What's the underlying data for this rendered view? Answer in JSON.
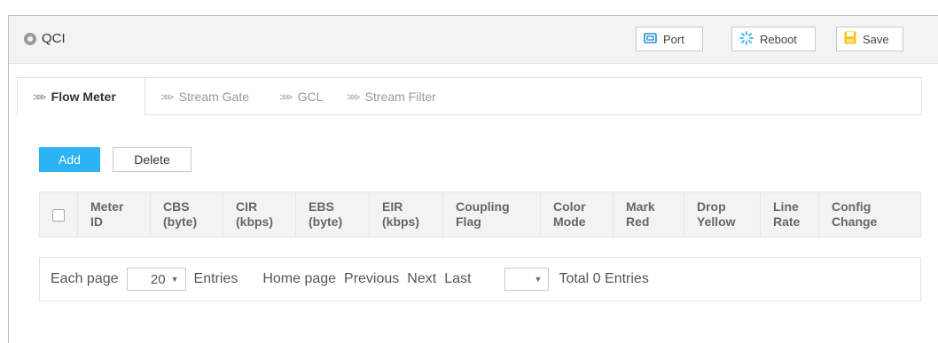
{
  "header": {
    "title": "QCI",
    "buttons": {
      "port": "Port",
      "reboot": "Reboot",
      "save": "Save"
    }
  },
  "tabs": [
    {
      "label": "Flow Meter",
      "active": true
    },
    {
      "label": "Stream Gate",
      "active": false
    },
    {
      "label": "GCL",
      "active": false
    },
    {
      "label": "Stream Filter",
      "active": false
    }
  ],
  "actions": {
    "add": "Add",
    "delete": "Delete"
  },
  "table": {
    "columns": [
      [
        "Meter",
        "ID"
      ],
      [
        "CBS",
        "(byte)"
      ],
      [
        "CIR",
        "(kbps)"
      ],
      [
        "EBS",
        "(byte)"
      ],
      [
        "EIR",
        "(kbps)"
      ],
      [
        "Coupling",
        "Flag"
      ],
      [
        "Color",
        "Mode"
      ],
      [
        "Mark",
        "Red"
      ],
      [
        "Drop",
        "Yellow"
      ],
      [
        "Line",
        "Rate"
      ],
      [
        "Config",
        "Change"
      ]
    ],
    "rows": []
  },
  "pager": {
    "each_page": "Each page",
    "page_size": "20",
    "entries": "Entries",
    "home": "Home page",
    "previous": "Previous",
    "next": "Next",
    "last": "Last",
    "page_select": "",
    "total": "Total 0 Entries"
  },
  "colors": {
    "accent": "#2bb3f3",
    "save_icon": "#f5c518",
    "reboot_icon": "#2bb3f3",
    "port_icon": "#2b8fd9"
  }
}
